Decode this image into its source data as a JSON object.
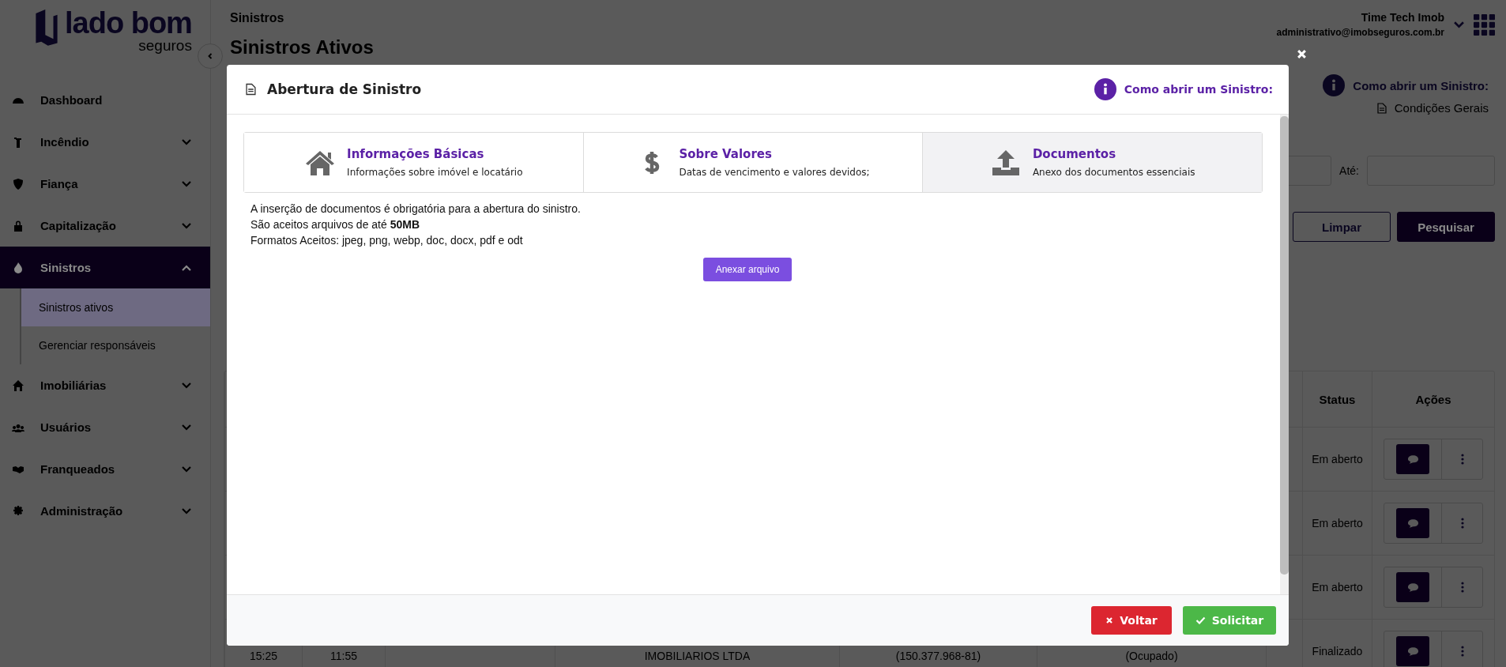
{
  "sidebar": {
    "logo": {
      "name": "lado bom",
      "tagline": "seguros"
    },
    "items": [
      {
        "kind": "link",
        "label": "Dashboard",
        "selected": false
      },
      {
        "kind": "group",
        "label": "Incêndio",
        "expanded": false,
        "selected": false
      },
      {
        "kind": "group",
        "label": "Fiança",
        "expanded": false,
        "selected": false
      },
      {
        "kind": "group",
        "label": "Capitalização",
        "expanded": false,
        "selected": false
      },
      {
        "kind": "group",
        "label": "Sinistros",
        "expanded": true,
        "selected": true,
        "children": [
          {
            "label": "Sinistros ativos",
            "selected": true
          },
          {
            "label": "Gerenciar responsáveis",
            "selected": false
          }
        ]
      },
      {
        "kind": "group",
        "label": "Imobiliárias",
        "expanded": false,
        "selected": false
      },
      {
        "kind": "group",
        "label": "Usuários",
        "expanded": false,
        "selected": false
      },
      {
        "kind": "group",
        "label": "Franqueados",
        "expanded": false,
        "selected": false
      },
      {
        "kind": "group",
        "label": "Administração",
        "expanded": false,
        "selected": false
      }
    ]
  },
  "header": {
    "breadcrumb": "Sinistros",
    "title": "Sinistros Ativos",
    "user_name": "Time Tech Imob",
    "user_email": "administrativo@imobseguros.com.br"
  },
  "help": {
    "link": "Como abrir um Sinistro:",
    "document": "Condições Gerais"
  },
  "filters": {
    "until_label": "Até:",
    "buttons": [
      {
        "label": "Limpar",
        "kind": "outline"
      },
      {
        "label": "Pesquisar",
        "kind": "solid"
      }
    ]
  },
  "table": {
    "columns": {
      "status": "Status",
      "actions": "Ações"
    },
    "rows": [
      {
        "status": "Em aberto"
      },
      {
        "status": "Em aberto"
      },
      {
        "status": "Em aberto"
      },
      {
        "column_1": "15:25",
        "column_2": "11:55",
        "column_4": "IMOBILIARIOS LTDA",
        "column_5": "(150.377.968-81)",
        "column_6": "(Ocupado)",
        "status": "Finalizado"
      }
    ]
  },
  "modal": {
    "title": "Abertura de Sinistro",
    "help_link": "Como abrir um Sinistro:",
    "steps": [
      {
        "title": "Informações Básicas",
        "subtitle": "Informações sobre imóvel e locatário",
        "selected": false
      },
      {
        "title": "Sobre Valores",
        "subtitle": "Datas de vencimento e valores devidos;",
        "selected": false
      },
      {
        "title": "Documentos",
        "subtitle": "Anexo dos documentos essenciais",
        "selected": true
      }
    ],
    "lines": [
      "A inserção de documentos é obrigatória para a abertura do sinistro.",
      "São aceitos arquivos de até **50MB**",
      "Formatos Aceitos: jpeg, png, webp, doc, docx, pdf e odt"
    ],
    "attach_button": "Anexar arquivo",
    "footer_buttons": [
      {
        "label": "Voltar",
        "kind": "cancel"
      },
      {
        "label": "Solicitar",
        "kind": "confirm"
      }
    ]
  }
}
